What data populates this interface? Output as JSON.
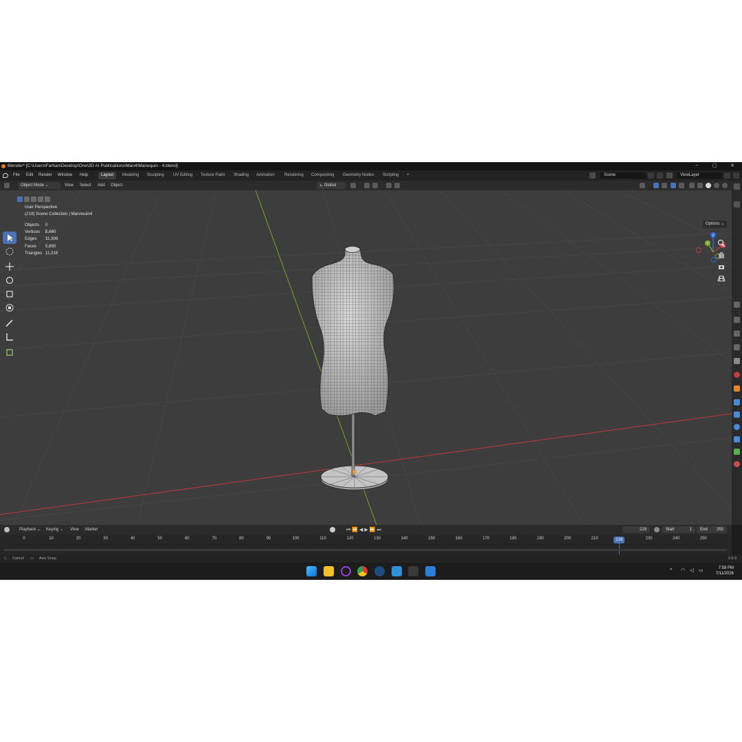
{
  "titlebar": {
    "title": "Blender* [C:\\Users\\Farhan\\Desktop\\One\\3D AI Publications\\Man4\\Manequin - 4.blend]",
    "minimize": "−",
    "maximize": "▢",
    "close": "✕"
  },
  "menus": [
    "File",
    "Edit",
    "Render",
    "Window",
    "Help"
  ],
  "workspaces": [
    "Layout",
    "Modeling",
    "Sculpting",
    "UV Editing",
    "Texture Paint",
    "Shading",
    "Animation",
    "Rendering",
    "Compositing",
    "Geometry Nodes",
    "Scripting",
    "+"
  ],
  "active_workspace": "Layout",
  "scene": {
    "name": "Scene",
    "view_layer": "ViewLayer"
  },
  "viewport_header": {
    "mode": "Object Mode",
    "menus": [
      "View",
      "Select",
      "Add",
      "Object"
    ],
    "orientation": "Global",
    "options": "Options"
  },
  "viewport_info": {
    "perspective": "User Perspective",
    "collection": "(219) Scene Collection | Manneuin4"
  },
  "stats": [
    {
      "label": "Objects",
      "value": "0 / 1"
    },
    {
      "label": "Vertices",
      "value": "5,660"
    },
    {
      "label": "Edges",
      "value": "11,308"
    },
    {
      "label": "Faces",
      "value": "5,650"
    },
    {
      "label": "Triangles",
      "value": "11,316"
    }
  ],
  "gizmo": {
    "x": "X",
    "y": "Y",
    "z": "Z"
  },
  "timeline": {
    "menus": [
      "Playback",
      "Keying",
      "View",
      "Marker"
    ],
    "current_frame": "219",
    "start_label": "Start",
    "start": "1",
    "end_label": "End",
    "end": "250",
    "ticks": [
      "0",
      "10",
      "20",
      "30",
      "40",
      "50",
      "60",
      "70",
      "80",
      "90",
      "100",
      "110",
      "120",
      "130",
      "140",
      "150",
      "160",
      "170",
      "180",
      "190",
      "200",
      "210",
      "220",
      "230",
      "240",
      "250"
    ],
    "current": 219
  },
  "statusbar": {
    "cancel": "Cancel",
    "axis_snap": "Axis Snap",
    "version": "3.6.9"
  },
  "taskbar": {
    "time": "7:58 PM",
    "date": "7/11/2026"
  },
  "colors": {
    "accent": "#4a72b8",
    "viewport": "#3d3d3d",
    "x_axis": "#c0393e",
    "y_axis": "#7ea32b"
  }
}
